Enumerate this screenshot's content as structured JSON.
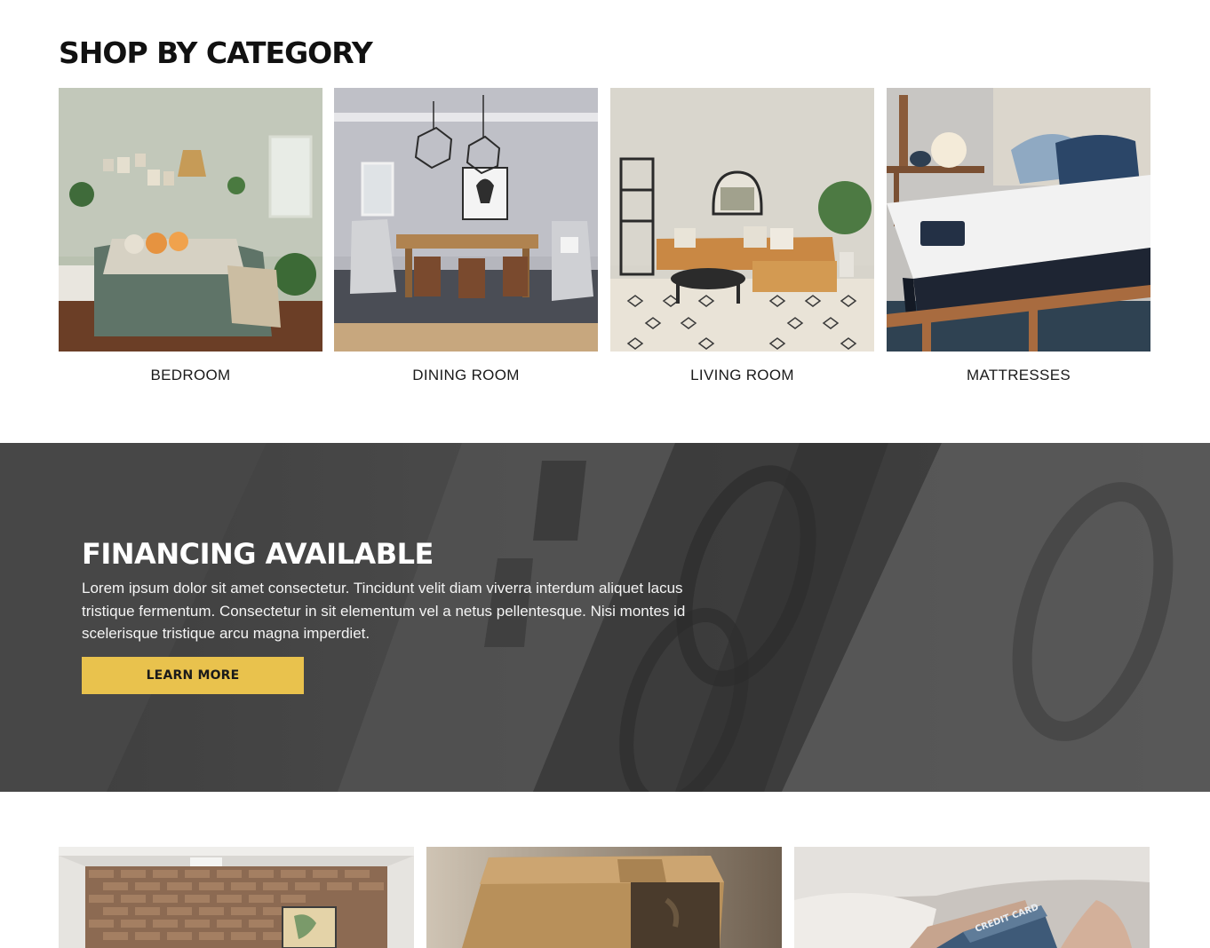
{
  "categories": {
    "title": "SHOP BY CATEGORY",
    "items": [
      {
        "label": "BEDROOM",
        "image": "bedroom-photo"
      },
      {
        "label": "DINING ROOM",
        "image": "dining-room-photo"
      },
      {
        "label": "LIVING ROOM",
        "image": "living-room-photo"
      },
      {
        "label": "MATTRESSES",
        "image": "mattress-photo"
      }
    ]
  },
  "financing": {
    "title": "FINANCING AVAILABLE",
    "text": "Lorem ipsum dolor sit amet consectetur. Tincidunt velit diam viverra interdum aliquet lacus tristique fermentum. Consectetur in sit elementum vel a netus pellentesque. Nisi montes id scelerisque tristique arcu magna imperdiet.",
    "button_label": "LEARN MORE",
    "background": "money-bill-photo",
    "accent_color": "#e9c24d"
  },
  "promos": [
    {
      "image": "brick-wall-room-photo"
    },
    {
      "image": "cardboard-box-photo"
    },
    {
      "image": "credit-card-photo",
      "card_text": "CREDIT CARD"
    }
  ]
}
